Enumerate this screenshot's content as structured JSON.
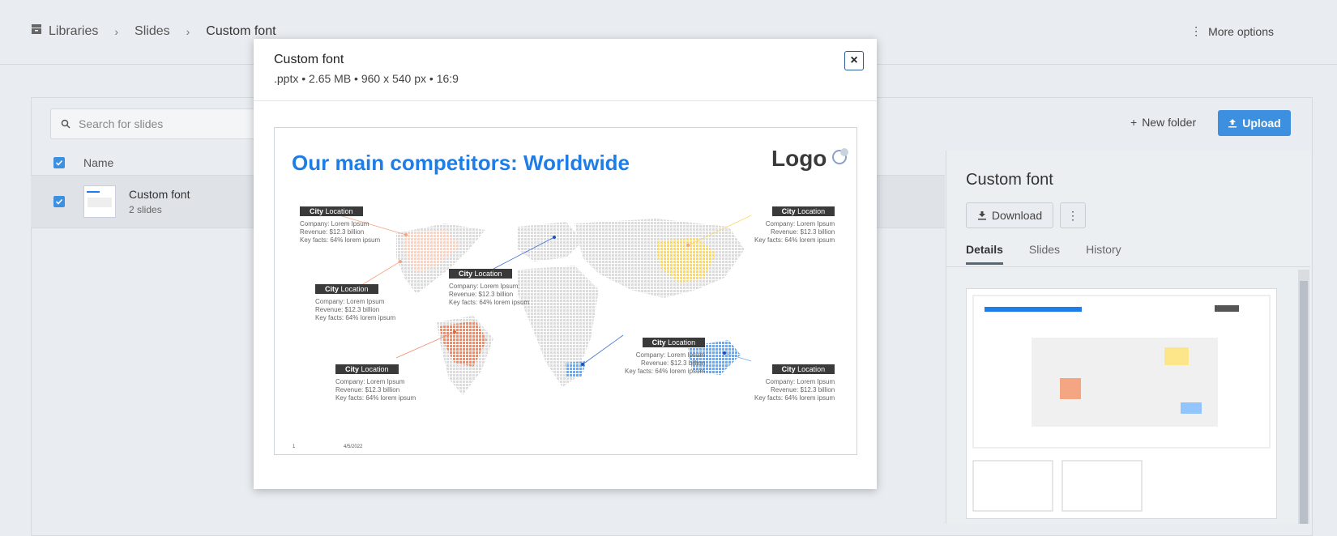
{
  "breadcrumb": {
    "items": [
      "Libraries",
      "Slides",
      "Custom font"
    ]
  },
  "header": {
    "more_options": "More options"
  },
  "toolbar": {
    "search_placeholder": "Search for slides",
    "new_folder": "New folder",
    "upload": "Upload"
  },
  "list": {
    "column_name": "Name",
    "rows": [
      {
        "title": "Custom font",
        "subtitle": "2 slides"
      }
    ]
  },
  "sidebar": {
    "title": "Custom font",
    "download": "Download",
    "tabs": [
      "Details",
      "Slides",
      "History"
    ],
    "active_tab": "Details"
  },
  "modal": {
    "title": "Custom font",
    "subtitle": ".pptx • 2.65 MB • 960 x 540 px • 16:9",
    "close": "×",
    "slide": {
      "title": "Our main competitors: Worldwide",
      "logo": "Logo",
      "city_bold": "City",
      "city_rest": "Location",
      "line1": "Company: Lorem Ipsum",
      "line2": "Revenue: $12.3 billion",
      "line3": "Key facts: 64% lorem ipsum",
      "page_number": "1",
      "date": "4/5/2022"
    }
  },
  "colors": {
    "accent": "#3d8fe0",
    "slide_title": "#1e7de6",
    "orange": "#f4a582",
    "yellow": "#fde68a",
    "blue": "#93c5fd"
  }
}
